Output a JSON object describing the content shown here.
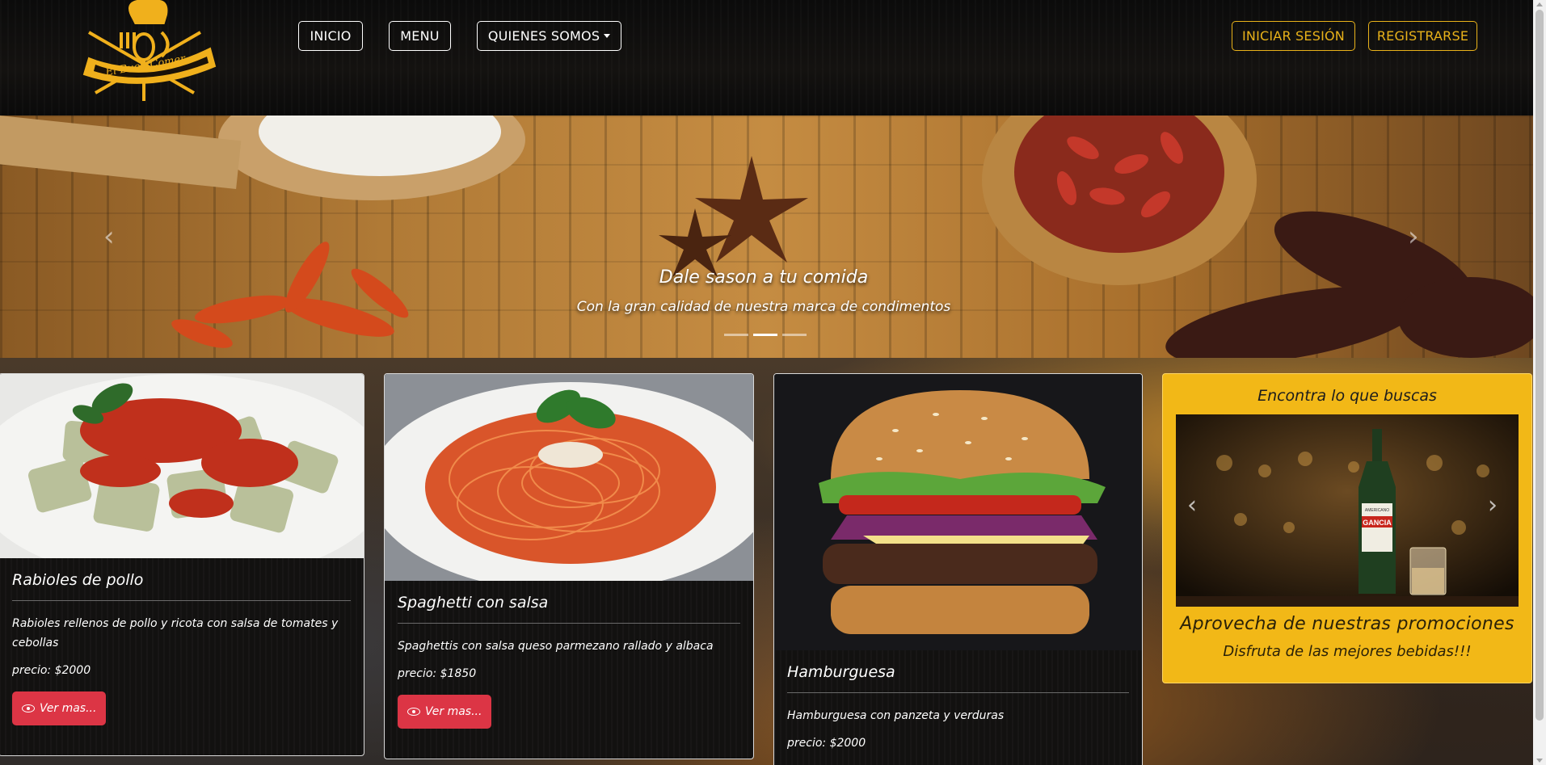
{
  "nav": {
    "logo_text": "El Buen Comer",
    "inicio": "INICIO",
    "menu": "MENU",
    "quienes_somos": "QUIENES SOMOS",
    "login": "INICIAR SESIÓN",
    "register": "REGISTRARSE"
  },
  "hero": {
    "title": "Dale sason a tu comida",
    "subtitle": "Con la gran calidad de nuestra marca de condimentos",
    "active_slide": 2,
    "slides_total": 3
  },
  "cards": [
    {
      "title": "Rabioles de pollo",
      "description": "Rabioles rellenos de pollo y ricota con salsa de tomates y cebollas",
      "price": "precio: $2000",
      "button": "Ver mas..."
    },
    {
      "title": "Spaghetti con salsa",
      "description": "Spaghettis con salsa queso parmezano rallado y albaca",
      "price": "precio: $1850",
      "button": "Ver mas..."
    },
    {
      "title": "Hamburguesa",
      "description": "Hamburguesa con panzeta y verduras",
      "price": "precio: $2000"
    }
  ],
  "promo": {
    "heading": "Encontra lo que buscas",
    "bottle_label_top": "AMERICANO",
    "bottle_label": "GANCIA",
    "title": "Aprovecha de nuestras promociones",
    "subtitle": "Disfruta de las mejores bebidas!!!"
  },
  "colors": {
    "gold": "#e9b21a",
    "promo_bg": "#f2b817",
    "button_red": "#dc3545",
    "card_bg": "#121110"
  }
}
